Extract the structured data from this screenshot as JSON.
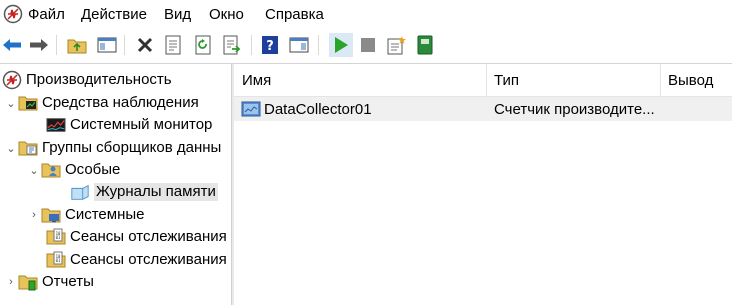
{
  "menu": {
    "items": [
      "Файл",
      "Действие",
      "Вид",
      "Окно",
      "Справка"
    ]
  },
  "toolbar": {
    "buttons": [
      "back-arrow-icon",
      "forward-arrow-icon",
      "folder-up-icon",
      "show-hide-tree-icon",
      "delete-icon",
      "properties-icon",
      "refresh-icon",
      "export-list-icon",
      "help-icon",
      "show-hide-action-pane-icon",
      "start-icon",
      "stop-icon",
      "new-item-icon",
      "notebook-icon"
    ]
  },
  "tree": {
    "root": "Производительность",
    "monitoring_tools": "Средства наблюдения",
    "system_monitor": "Системный монитор",
    "collector_sets": "Группы сборщиков данны",
    "user_defined": "Особые",
    "memory_logs": "Журналы памяти",
    "system": "Системные",
    "trace_sessions_1": "Сеансы отслеживания",
    "trace_sessions_2": "Сеансы отслеживания",
    "reports": "Отчеты"
  },
  "list": {
    "columns": [
      "Имя",
      "Тип",
      "Вывод"
    ],
    "rows": [
      {
        "name": "DataCollector01",
        "type": "Счетчик производите...",
        "output": ""
      }
    ]
  },
  "colors": {
    "selection": "#e5e5e5",
    "row_highlight": "#f0f0f0",
    "accent_blue": "#1e73c8",
    "start_green": "#2aa52a"
  }
}
